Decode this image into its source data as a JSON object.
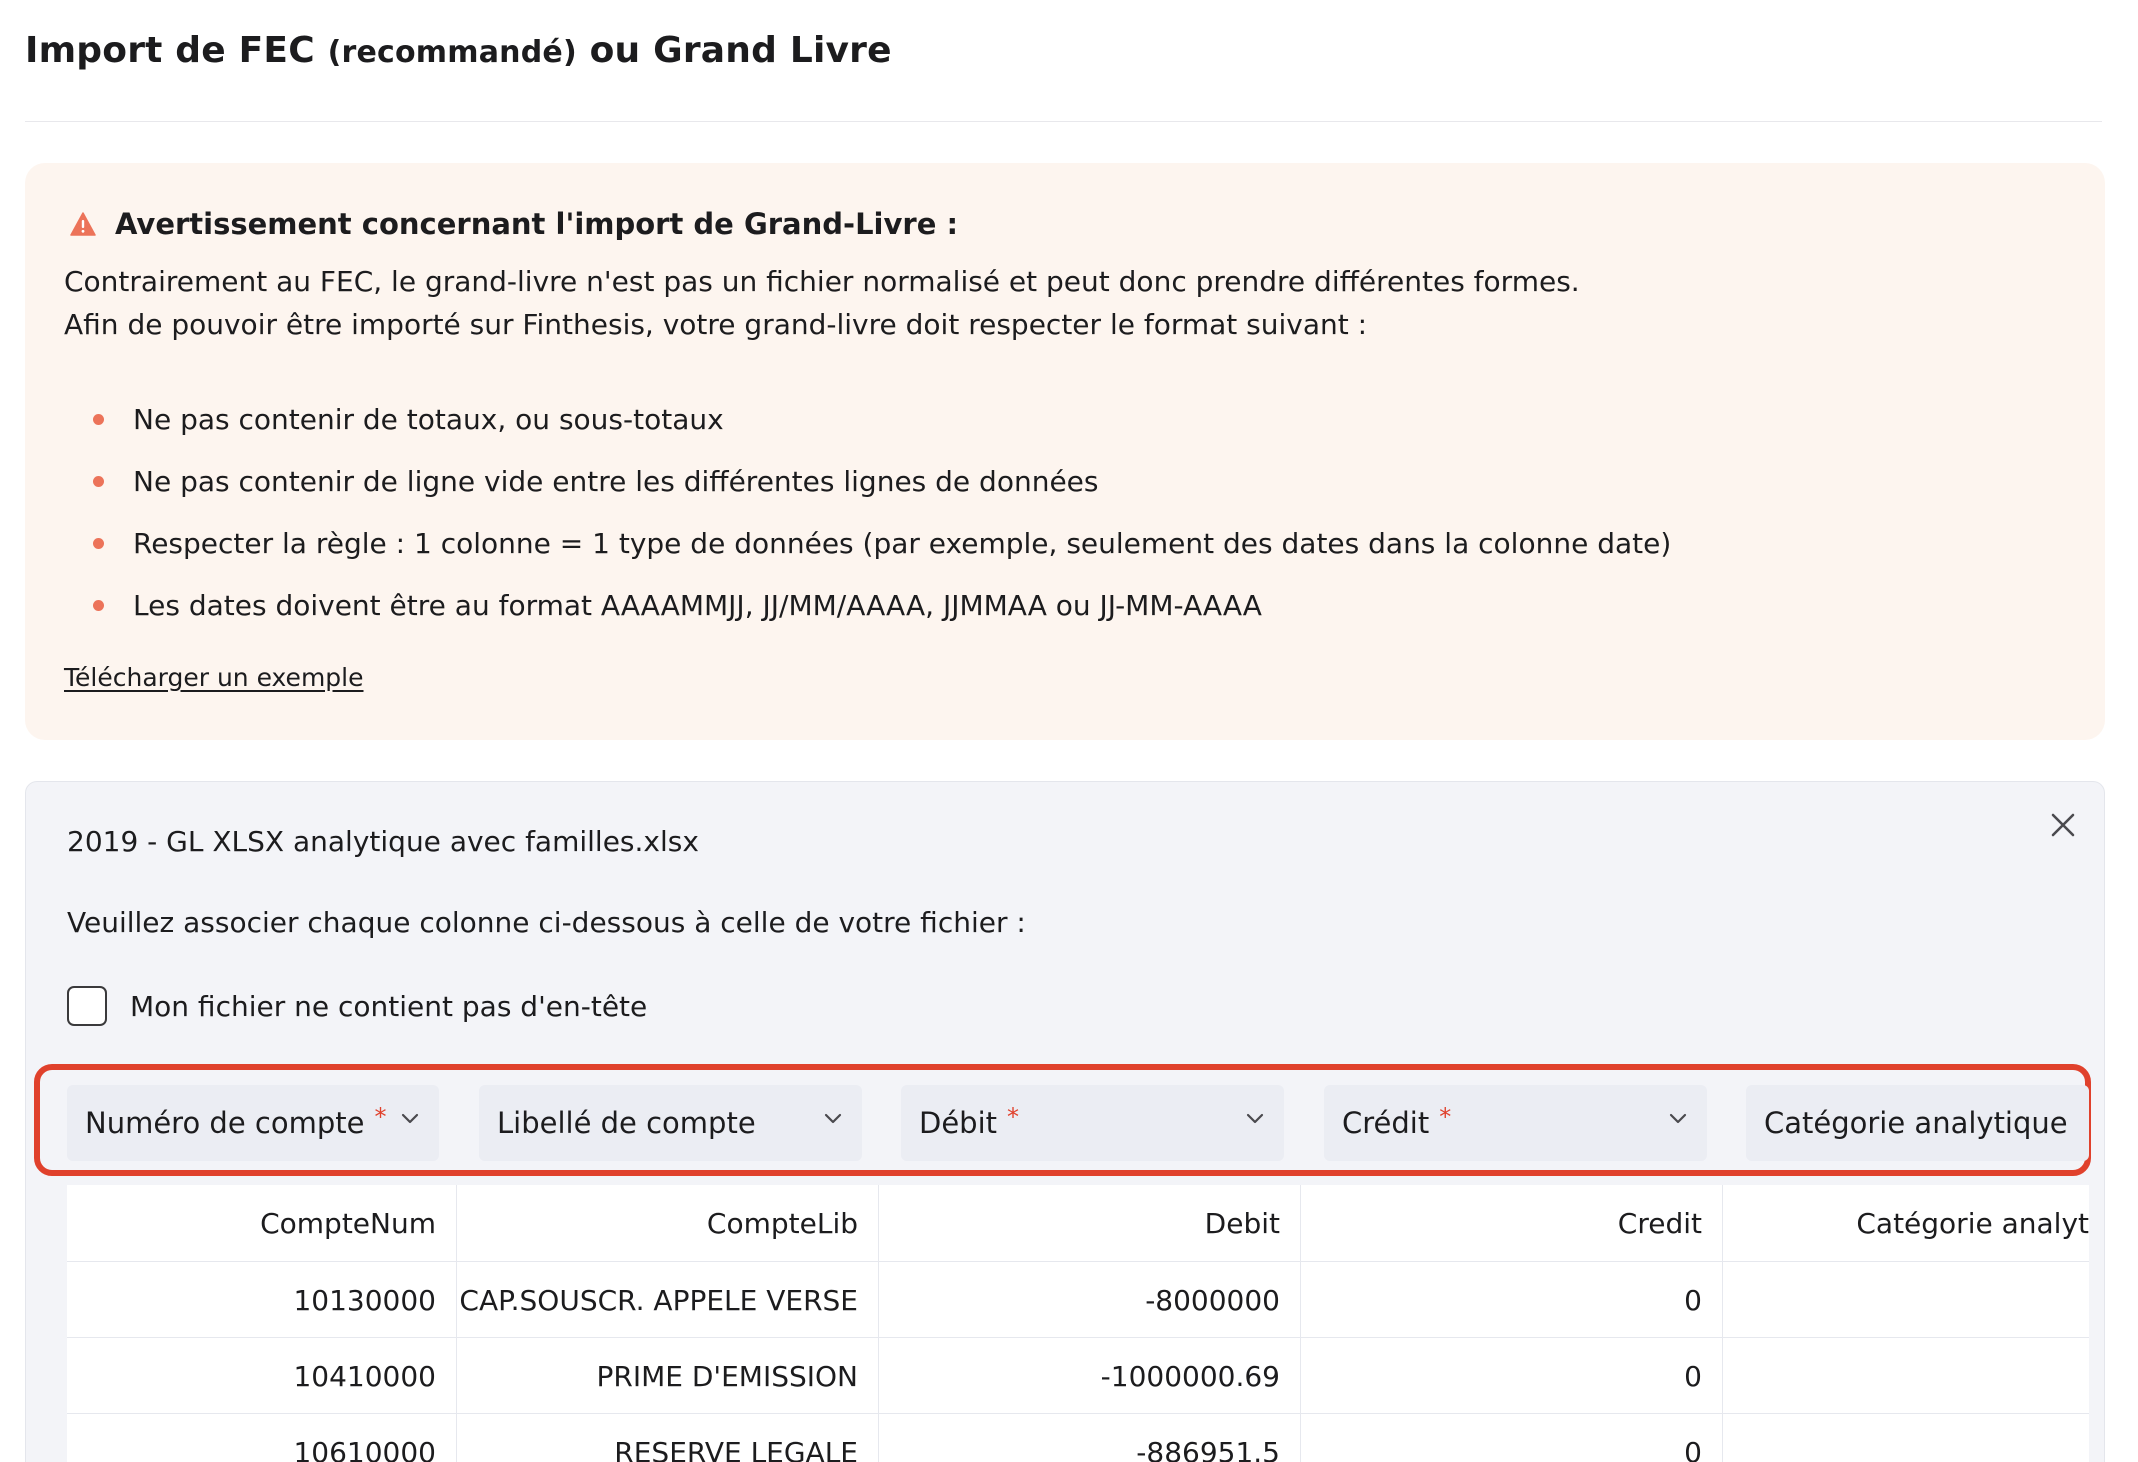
{
  "page": {
    "title_main": "Import de FEC",
    "title_sub": "(recommandé)",
    "title_end": "ou Grand Livre"
  },
  "warning": {
    "title": "Avertissement concernant l'import de Grand-Livre :",
    "line1": "Contrairement au FEC, le grand-livre n'est pas un fichier normalisé et peut donc prendre différentes formes.",
    "line2": "Afin de pouvoir être importé sur Finthesis, votre grand-livre doit respecter le format suivant :",
    "rules": [
      "Ne pas contenir de totaux, ou sous-totaux",
      "Ne pas contenir de ligne vide entre les différentes lignes de données",
      "Respecter la règle : 1 colonne = 1 type de données (par exemple, seulement des dates dans la colonne date)",
      "Les dates doivent être au format AAAAMMJJ, JJ/MM/AAAA, JJMMAA ou JJ-MM-AAAA"
    ],
    "download_link": "Télécharger un exemple",
    "accent_color": "#ec7359",
    "background_color": "#fdf5ef"
  },
  "import": {
    "file_name": "2019 - GL XLSX analytique avec familles.xlsx",
    "instruction": "Veuillez associer chaque colonne ci-dessous à celle de votre fichier :",
    "no_header_label": "Mon fichier ne contient pas d'en-tête",
    "no_header_checked": false,
    "required_marker": "*",
    "highlight_color": "#e0412c",
    "mappings": [
      {
        "label": "Numéro de compte",
        "required": true
      },
      {
        "label": "Libellé de compte",
        "required": false
      },
      {
        "label": "Débit",
        "required": true
      },
      {
        "label": "Crédit",
        "required": true
      },
      {
        "label": "Catégorie analytique",
        "required": false
      }
    ],
    "table": {
      "headers": [
        "CompteNum",
        "CompteLib",
        "Debit",
        "Credit",
        "Catégorie analyt"
      ],
      "rows": [
        [
          "10130000",
          "CAP.SOUSCR. APPELE VERSE",
          "-8000000",
          "0",
          ""
        ],
        [
          "10410000",
          "PRIME D'EMISSION",
          "-1000000.69",
          "0",
          ""
        ],
        [
          "10610000",
          "RESERVE LEGALE",
          "-886951.5",
          "0",
          ""
        ]
      ]
    }
  }
}
